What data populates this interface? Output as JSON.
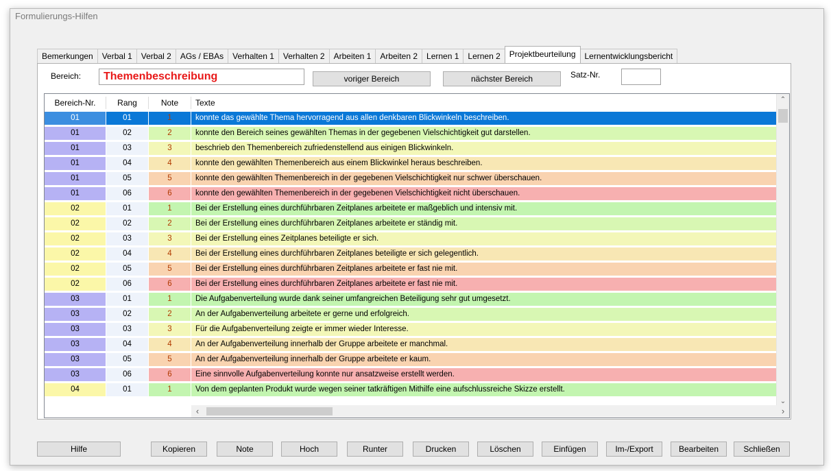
{
  "window": {
    "title": "Formulierungs-Hilfen"
  },
  "tabs": [
    {
      "label": "Bemerkungen"
    },
    {
      "label": "Verbal 1"
    },
    {
      "label": "Verbal 2"
    },
    {
      "label": "AGs / EBAs"
    },
    {
      "label": "Verhalten 1"
    },
    {
      "label": "Verhalten 2"
    },
    {
      "label": "Arbeiten 1"
    },
    {
      "label": "Arbeiten 2"
    },
    {
      "label": "Lernen 1"
    },
    {
      "label": "Lernen 2"
    },
    {
      "label": "Projektbeurteilung",
      "active": true
    },
    {
      "label": "Lernentwicklungsbericht"
    }
  ],
  "bereich": {
    "label": "Bereich:",
    "value": "Themenbeschreibung",
    "prev_button": "voriger Bereich",
    "next_button": "nächster Bereich",
    "satz_label": "Satz-Nr.",
    "satz_value": ""
  },
  "grid": {
    "columns": [
      "Bereich-Nr.",
      "Rang",
      "Note",
      "Texte"
    ],
    "rows": [
      [
        "01",
        "01",
        "1",
        "konnte das gewählte Thema hervorragend aus allen denkbaren Blickwinkeln beschreiben."
      ],
      [
        "01",
        "02",
        "2",
        "konnte den Bereich seines gewählten Themas in der gegebenen Vielschichtigkeit gut darstellen."
      ],
      [
        "01",
        "03",
        "3",
        "beschrieb den Themenbereich zufriedenstellend aus einigen Blickwinkeln."
      ],
      [
        "01",
        "04",
        "4",
        "konnte den gewählten Themenbereich aus einem Blickwinkel heraus beschreiben."
      ],
      [
        "01",
        "05",
        "5",
        "konnte den gewählten Themenbereich in der gegebenen Vielschichtigkeit nur schwer überschauen."
      ],
      [
        "01",
        "06",
        "6",
        "konnte den gewählten Themenbereich in der gegebenen Vielschichtigkeit nicht überschauen."
      ],
      [
        "02",
        "01",
        "1",
        "Bei der Erstellung eines durchführbaren Zeitplanes arbeitete er maßgeblich und intensiv mit."
      ],
      [
        "02",
        "02",
        "2",
        "Bei der Erstellung eines durchführbaren Zeitplanes arbeitete er ständig mit."
      ],
      [
        "02",
        "03",
        "3",
        "Bei der Erstellung eines Zeitplanes beteiligte er sich."
      ],
      [
        "02",
        "04",
        "4",
        "Bei der Erstellung eines durchführbaren Zeitplanes beteiligte er sich gelegentlich."
      ],
      [
        "02",
        "05",
        "5",
        "Bei der Erstellung eines durchführbaren Zeitplanes arbeitete er fast nie mit."
      ],
      [
        "02",
        "06",
        "6",
        "Bei der Erstellung eines durchführbaren Zeitplanes arbeitete er fast nie mit."
      ],
      [
        "03",
        "01",
        "1",
        "Die Aufgabenverteilung wurde dank seiner umfangreichen Beteiligung sehr gut umgesetzt."
      ],
      [
        "03",
        "02",
        "2",
        "An der Aufgabenverteilung arbeitete er gerne und erfolgreich."
      ],
      [
        "03",
        "03",
        "3",
        "Für die Aufgabenverteilung zeigte er immer wieder Interesse."
      ],
      [
        "03",
        "04",
        "4",
        "An der Aufgabenverteilung innerhalb der Gruppe arbeitete er manchmal."
      ],
      [
        "03",
        "05",
        "5",
        "An der Aufgabenverteilung innerhalb der Gruppe arbeitete er kaum."
      ],
      [
        "03",
        "06",
        "6",
        "Eine sinnvolle Aufgabenverteilung konnte nur ansatzweise erstellt werden."
      ],
      [
        "04",
        "01",
        "1",
        "Von dem geplanten Produkt wurde wegen seiner tatkräftigen Mithilfe eine aufschlussreiche Skizze erstellt."
      ]
    ],
    "selected_row": 0
  },
  "colors": {
    "bereich_odd": "#b6b2f4",
    "bereich_even": "#fbf7a8",
    "rang_bg": "#eef3fb",
    "note_1": "#c3f5b0",
    "note_2": "#d8f7b3",
    "note_3": "#f3f7b8",
    "note_4": "#f8e7b4",
    "note_5": "#f9d3b0",
    "note_6": "#f7b0b0",
    "selected": "#0a78d7"
  },
  "buttons": {
    "help": "Hilfe",
    "copy": "Kopieren",
    "note": "Note",
    "up": "Hoch",
    "down": "Runter",
    "print": "Drucken",
    "delete": "Löschen",
    "insert": "Einfügen",
    "importexport": "Im-/Export",
    "edit": "Bearbeiten",
    "close": "Schließen"
  }
}
